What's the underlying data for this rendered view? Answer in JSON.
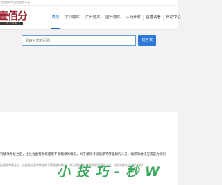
{
  "top_notice": "搜题快 专业的题库平台！",
  "logo": {
    "text": "壹佰分",
    "tagline": "专 业 题 库"
  },
  "nav": {
    "items": [
      {
        "label": "首页",
        "active": true
      },
      {
        "label": "学习题库",
        "active": false
      },
      {
        "label": "广开题库",
        "active": false
      },
      {
        "label": "国开题库",
        "active": false
      },
      {
        "label": "江苏开放",
        "active": false
      },
      {
        "label": "直播试看",
        "active": false
      },
      {
        "label": "帮助中心",
        "active": false
      }
    ]
  },
  "search": {
    "placeholder": "请输入您的问题",
    "button_label": "找答案"
  },
  "content": {
    "paragraph1": "行绩效考核之后，往往会出现考核结果不够理想的情况。对于绩效考核结果不够理想的人员，组织的做法应该是为他们",
    "paragraph2": "行绩效考核之后，往往会出现考核结果不够理想的情况。对于绩效考核结果不够理想的人员，组织的做法应该是为他们",
    "watermark": "小 技 巧 - 秒 W"
  },
  "colors": {
    "brand": "#9b2230",
    "accent": "#2d7ad6",
    "watermark": "#14963c"
  }
}
